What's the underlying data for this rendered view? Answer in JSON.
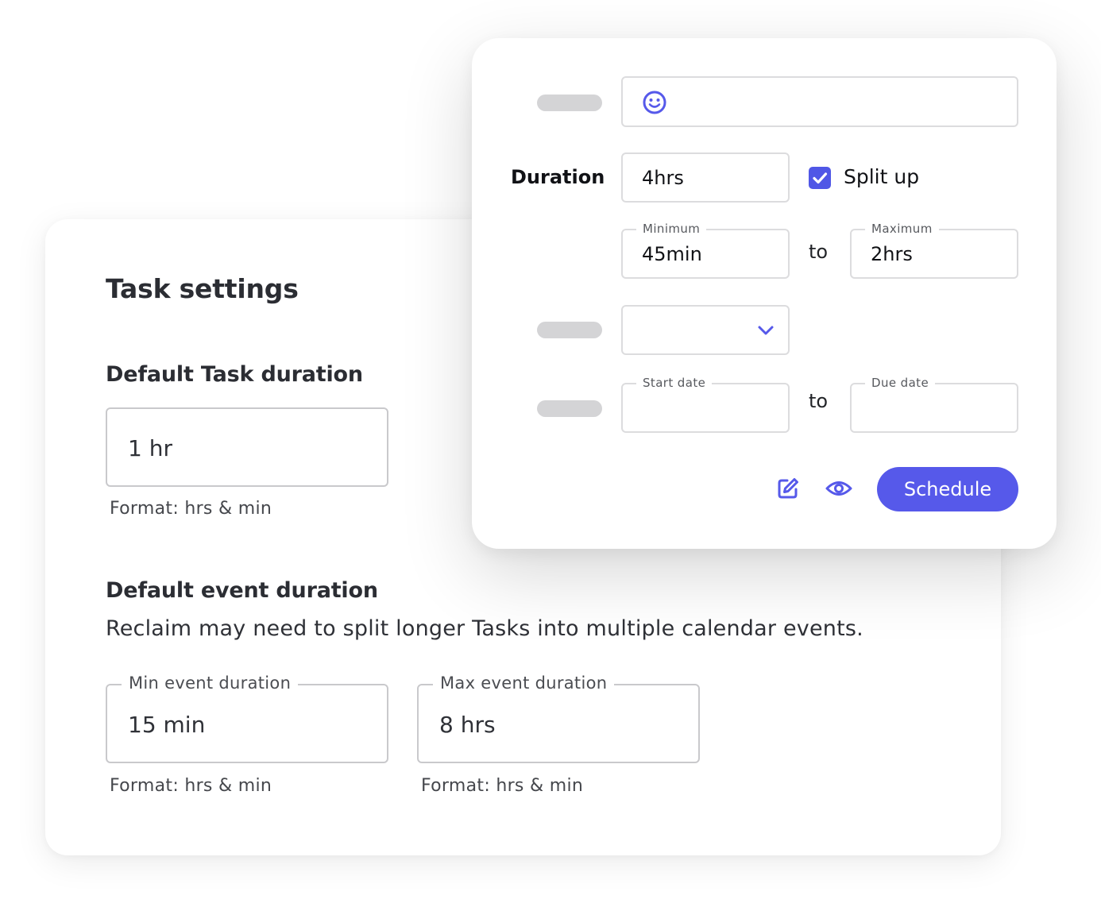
{
  "settings": {
    "title": "Task settings",
    "default_task_duration": {
      "heading": "Default Task duration",
      "value": "1 hr",
      "helper": "Format: hrs & min"
    },
    "default_event_duration": {
      "heading": "Default event duration",
      "description": "Reclaim may need to split longer Tasks into multiple calendar events.",
      "min": {
        "label": "Min event duration",
        "value": "15 min",
        "helper": "Format: hrs & min"
      },
      "max": {
        "label": "Max event duration",
        "value": "8 hrs",
        "helper": "Format: hrs & min"
      }
    }
  },
  "task_form": {
    "title_field": {
      "icon": "smiley-icon",
      "value": ""
    },
    "duration": {
      "label": "Duration",
      "value": "4hrs",
      "split_up": {
        "label": "Split up",
        "checked": true
      },
      "minimum": {
        "label": "Minimum",
        "value": "45min"
      },
      "to_label": "to",
      "maximum": {
        "label": "Maximum",
        "value": "2hrs"
      }
    },
    "priority_select": {
      "value": "",
      "icon": "chevron-down-icon"
    },
    "dates": {
      "start": {
        "label": "Start date",
        "value": ""
      },
      "to_label": "to",
      "due": {
        "label": "Due date",
        "value": ""
      }
    },
    "actions": {
      "edit_icon": "edit-icon",
      "visibility_icon": "eye-icon",
      "schedule_label": "Schedule"
    }
  },
  "colors": {
    "accent": "#5659EA",
    "placeholder": "#D4D4D6",
    "border": "#C9C9CC"
  }
}
